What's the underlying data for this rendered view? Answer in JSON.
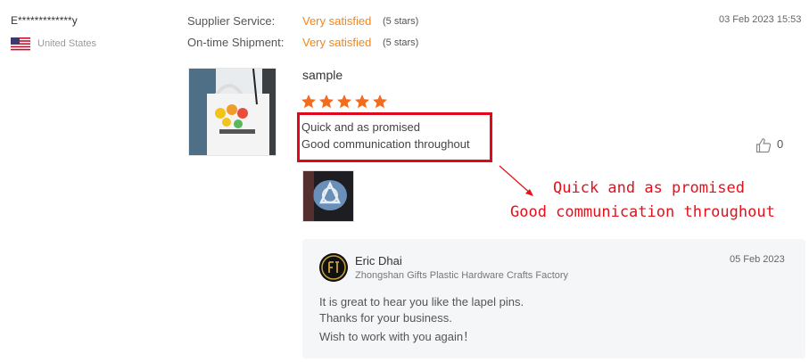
{
  "reviewer": {
    "name": "E*************y",
    "country": "United States"
  },
  "ratings": [
    {
      "label": "Supplier Service:",
      "value": "Very satisfied",
      "stars": "(5 stars)"
    },
    {
      "label": "On-time Shipment:",
      "value": "Very satisfied",
      "stars": "(5 stars)"
    }
  ],
  "review_date": "03 Feb 2023 15:53",
  "product": {
    "title": "sample",
    "star_rating": 5
  },
  "review_lines": [
    "Quick and as promised",
    "Good communication throughout"
  ],
  "likes": "0",
  "annotation": {
    "line1": "Quick and as promised",
    "line2": "Good communication throughout"
  },
  "reply": {
    "seller_name": "Eric Dhai",
    "company": "Zhongshan Gifts Plastic Hardware Crafts Factory",
    "date": "05 Feb 2023",
    "lines": [
      "It is great to hear you like the lapel pins.",
      "Thanks for your business.",
      "Wish to work with you again！"
    ]
  },
  "colors": {
    "accent_orange": "#f0861e",
    "star_orange": "#f36b1c",
    "annotation_red": "#e3111b"
  },
  "icons": {
    "like": "thumbs-up-icon",
    "flag": "us-flag-icon"
  }
}
